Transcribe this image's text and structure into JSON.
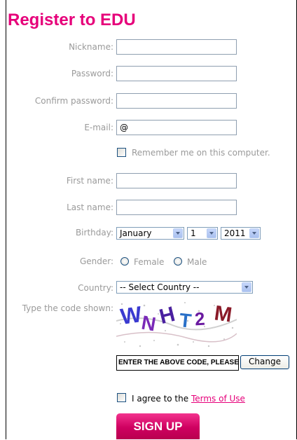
{
  "title": "Register to EDU",
  "fields": {
    "nickname": {
      "label": "Nickname:",
      "value": ""
    },
    "password": {
      "label": "Password:",
      "value": ""
    },
    "confirm": {
      "label": "Confirm password:",
      "value": ""
    },
    "email": {
      "label": "E-mail:",
      "value": "@"
    },
    "first_name": {
      "label": "First name:",
      "value": ""
    },
    "last_name": {
      "label": "Last name:",
      "value": ""
    }
  },
  "remember": {
    "label": "Remember me on this computer.",
    "checked": false
  },
  "birthday": {
    "label": "Birthday:",
    "month": "January",
    "day": "1",
    "year": "2011"
  },
  "gender": {
    "label": "Gender:",
    "female": "Female",
    "male": "Male"
  },
  "country": {
    "label": "Country:",
    "selected": "-- Select Country --"
  },
  "captcha": {
    "label": "Type the code shown:",
    "code_chars": [
      "W",
      "N",
      "H",
      "T",
      "2",
      "M"
    ],
    "input_value": "ENTER THE ABOVE CODE, PLEASE",
    "change_label": "Change"
  },
  "agree": {
    "prefix": "I agree to the ",
    "link": "Terms of Use",
    "checked": false
  },
  "signup_label": "SIGN UP",
  "colors": {
    "brand": "#e6007a",
    "label": "#9a9a9a"
  }
}
